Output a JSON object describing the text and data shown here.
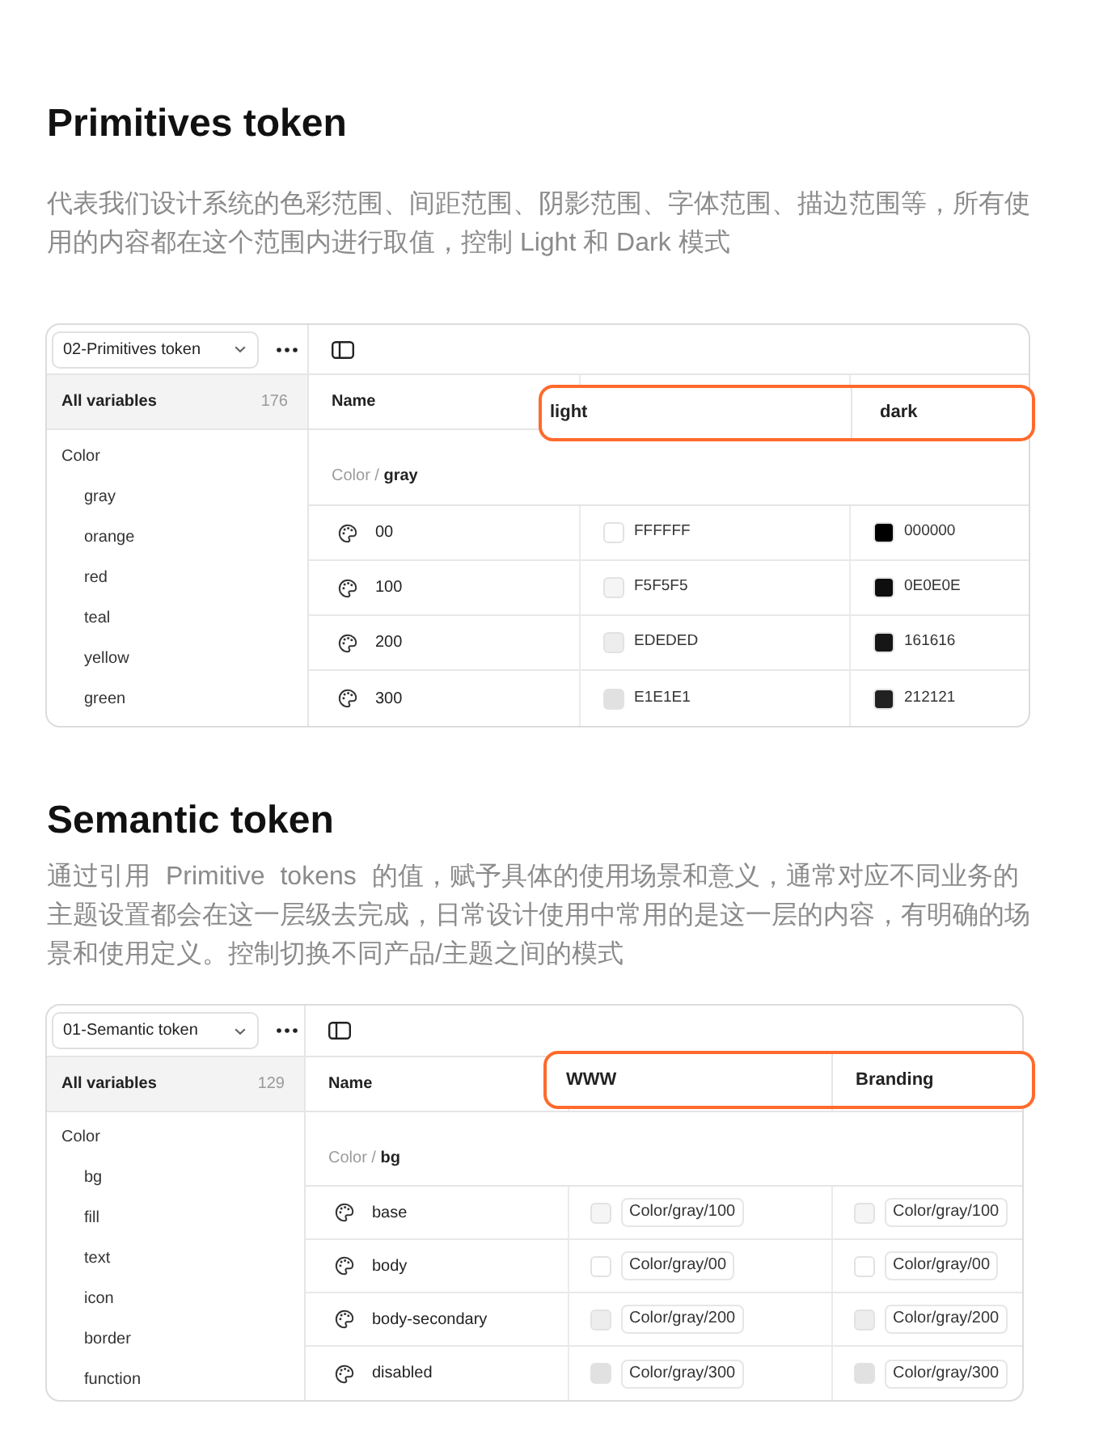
{
  "sections": [
    {
      "title": "Primitives token",
      "description": "代表我们设计系统的色彩范围、间距范围、阴影范围、字体范围、描边范围等，所有使用的内容都在这个范围内进行取值，控制 Light 和 Dark 模式",
      "panel": {
        "collection": "02-Primitives token",
        "all_variables": {
          "label": "All variables",
          "count": "176",
          "selected": true
        },
        "tree": [
          {
            "label": "Color",
            "selected": false,
            "children": [
              {
                "label": "gray",
                "selected": false
              },
              {
                "label": "orange",
                "selected": false
              },
              {
                "label": "red",
                "selected": false
              },
              {
                "label": "teal",
                "selected": false
              },
              {
                "label": "yellow",
                "selected": false
              },
              {
                "label": "green",
                "selected": false
              }
            ]
          }
        ],
        "columns": [
          {
            "label": "Name",
            "highlighted": false
          },
          {
            "label": "light",
            "highlighted": true
          },
          {
            "label": "dark",
            "highlighted": true
          }
        ],
        "group_path": "Color / **gray**",
        "rows": [
          {
            "name": "00",
            "values": [
              {
                "kind": "hex",
                "color": "#ffffff",
                "text": "FFFFFF"
              },
              {
                "kind": "hex",
                "color": "#000000",
                "text": "000000"
              }
            ]
          },
          {
            "name": "100",
            "values": [
              {
                "kind": "hex",
                "color": "#f5f5f5",
                "text": "F5F5F5"
              },
              {
                "kind": "hex",
                "color": "#0e0e0e",
                "text": "0E0E0E"
              }
            ]
          },
          {
            "name": "200",
            "values": [
              {
                "kind": "hex",
                "color": "#ededed",
                "text": "EDEDED"
              },
              {
                "kind": "hex",
                "color": "#161616",
                "text": "161616"
              }
            ]
          },
          {
            "name": "300",
            "values": [
              {
                "kind": "hex",
                "color": "#e1e1e1",
                "text": "E1E1E1"
              },
              {
                "kind": "hex",
                "color": "#212121",
                "text": "212121"
              }
            ]
          }
        ]
      }
    },
    {
      "title": "Semantic token",
      "description": "通过引用 Primitive tokens 的值，赋予具体的使用场景和意义，通常对应不同业务的主题设置都会在这一层级去完成，日常设计使用中常用的是这一层的内容，有明确的场景和使用定义。控制切换不同产品/主题之间的模式",
      "panel": {
        "collection": "01-Semantic token",
        "all_variables": {
          "label": "All variables",
          "count": "129",
          "selected": true
        },
        "tree": [
          {
            "label": "Color",
            "selected": false,
            "children": [
              {
                "label": "bg",
                "selected": false
              },
              {
                "label": "fill",
                "selected": false
              },
              {
                "label": "text",
                "selected": false
              },
              {
                "label": "icon",
                "selected": false
              },
              {
                "label": "border",
                "selected": false
              },
              {
                "label": "function",
                "selected": false
              }
            ]
          }
        ],
        "columns": [
          {
            "label": "Name",
            "highlighted": false
          },
          {
            "label": "WWW",
            "highlighted": true
          },
          {
            "label": "Branding",
            "highlighted": true
          }
        ],
        "group_path": "Color / **bg**",
        "rows": [
          {
            "name": "base",
            "values": [
              {
                "kind": "alias",
                "color": "#f5f5f5",
                "text": "Color/gray/100"
              },
              {
                "kind": "alias",
                "color": "#f5f5f5",
                "text": "Color/gray/100"
              }
            ]
          },
          {
            "name": "body",
            "values": [
              {
                "kind": "alias",
                "color": "#ffffff",
                "text": "Color/gray/00"
              },
              {
                "kind": "alias",
                "color": "#ffffff",
                "text": "Color/gray/00"
              }
            ]
          },
          {
            "name": "body-secondary",
            "values": [
              {
                "kind": "alias",
                "color": "#ededed",
                "text": "Color/gray/200"
              },
              {
                "kind": "alias",
                "color": "#ededed",
                "text": "Color/gray/200"
              }
            ]
          },
          {
            "name": "disabled",
            "values": [
              {
                "kind": "alias",
                "color": "#e1e1e1",
                "text": "Color/gray/300"
              },
              {
                "kind": "alias",
                "color": "#e1e1e1",
                "text": "Color/gray/300"
              }
            ]
          }
        ]
      }
    }
  ]
}
